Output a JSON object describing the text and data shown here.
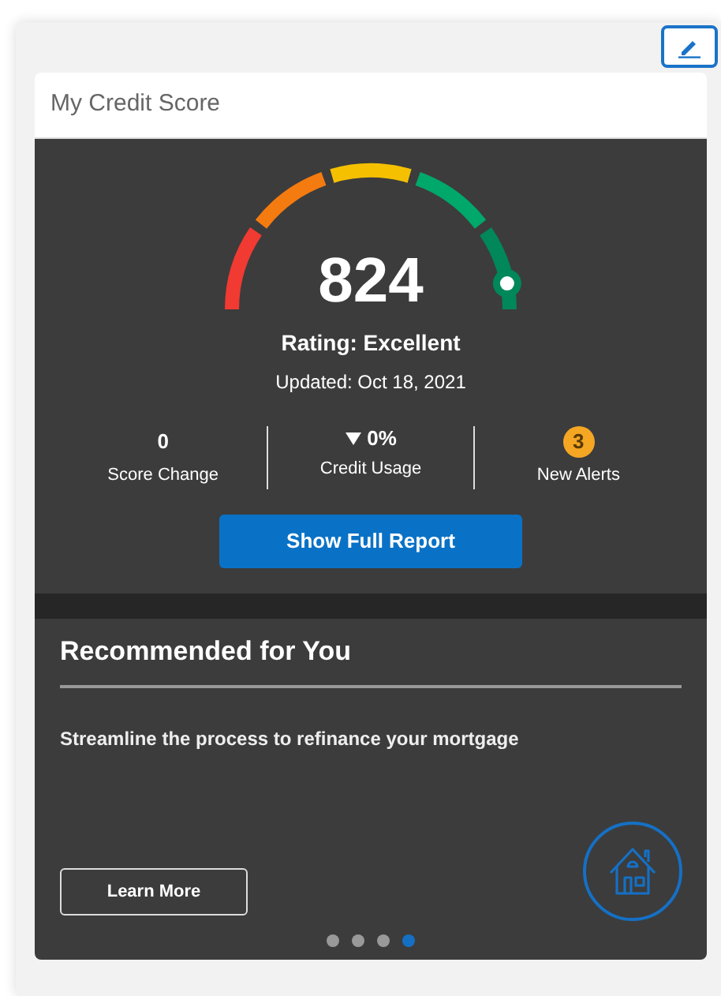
{
  "card": {
    "title": "My Credit Score"
  },
  "score": {
    "value": "824",
    "rating": "Rating: Excellent",
    "updated": "Updated: Oct 18, 2021",
    "gauge": {
      "level": 0.94
    }
  },
  "stats": [
    {
      "kind": "plain",
      "value": "0",
      "label": "Score Change"
    },
    {
      "kind": "trend-down",
      "value": "0%",
      "label": "Credit Usage"
    },
    {
      "kind": "badge",
      "value": "3",
      "label": "New Alerts",
      "color": "#f5a623"
    }
  ],
  "report_button": "Show Full Report",
  "recommended": {
    "title": "Recommended for You",
    "text": "Streamline the process to refinance your mortgage",
    "button": "Learn More",
    "dots": [
      {
        "selected": false
      },
      {
        "selected": false
      },
      {
        "selected": false
      },
      {
        "selected": true
      }
    ]
  }
}
